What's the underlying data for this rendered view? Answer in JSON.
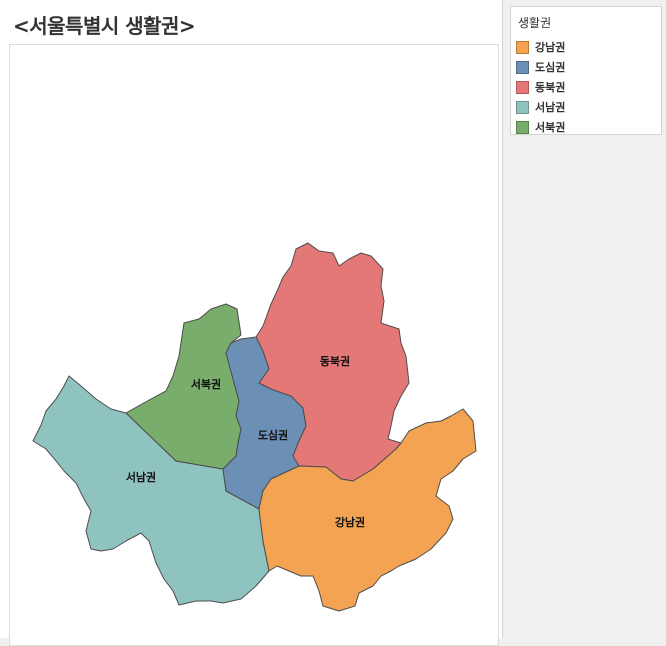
{
  "title": "<서울특별시 생활권>",
  "legend": {
    "title": "생활권",
    "items": [
      {
        "label": "강남권",
        "color": "#f4a352"
      },
      {
        "label": "도심권",
        "color": "#6b8fb5"
      },
      {
        "label": "동북권",
        "color": "#e47877"
      },
      {
        "label": "서남권",
        "color": "#8fc3bf"
      },
      {
        "label": "서북권",
        "color": "#78ad6b"
      }
    ]
  },
  "regions": {
    "dongbuk": {
      "label": "동북권",
      "color": "#e47877"
    },
    "seobuk": {
      "label": "서북권",
      "color": "#78ad6b"
    },
    "dosim": {
      "label": "도심권",
      "color": "#6b8fb5"
    },
    "seonam": {
      "label": "서남권",
      "color": "#8fc3bf"
    },
    "gangnam": {
      "label": "강남권",
      "color": "#f4a352"
    }
  }
}
